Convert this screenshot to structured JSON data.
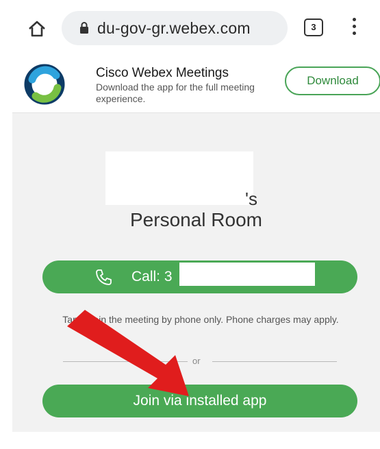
{
  "browser": {
    "url": "du-gov-gr.webex.com",
    "tab_count": "3"
  },
  "banner": {
    "app_name": "Cisco Webex Meetings",
    "subtitle": "Download the app for the full meeting experience.",
    "download_label": "Download"
  },
  "meeting": {
    "owner_suffix": "'s",
    "room_title": "Personal Room",
    "call_label": "Call: 3",
    "call_note": "Tap to join the meeting by phone only. Phone charges may apply.",
    "or_label": "or",
    "join_label": "Join via installed app"
  },
  "colors": {
    "accent_green": "#4aa955",
    "annotation_arrow": "#e01d1d"
  },
  "icons": [
    "home-icon",
    "lock-icon",
    "tab-count-icon",
    "more-vert-icon",
    "webex-logo",
    "phone-icon",
    "annotation-arrow"
  ]
}
